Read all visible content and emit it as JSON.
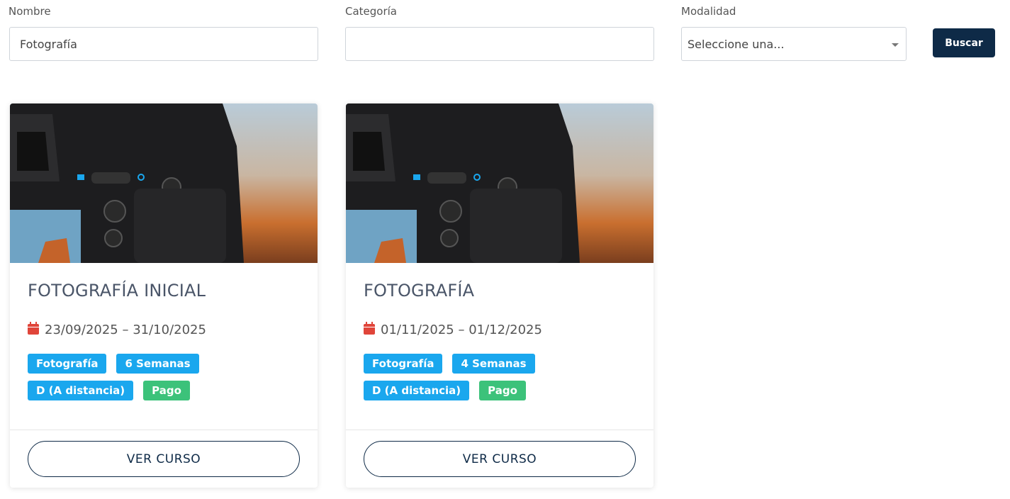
{
  "filters": {
    "name_label": "Nombre",
    "name_value": "Fotografía",
    "category_label": "Categoría",
    "category_value": "",
    "mode_label": "Modalidad",
    "mode_selected": "Seleccione una...",
    "search_button": "Buscar"
  },
  "courses": [
    {
      "title": "FOTOGRAFÍA INICIAL",
      "dates": "23/09/2025 – 31/10/2025",
      "category": "Fotografía",
      "duration": "6 Semanas",
      "mode": "D (A distancia)",
      "price": "Pago",
      "button": "VER CURSO"
    },
    {
      "title": "FOTOGRAFÍA",
      "dates": "01/11/2025 – 01/12/2025",
      "category": "Fotografía",
      "duration": "4 Semanas",
      "mode": "D (A distancia)",
      "price": "Pago",
      "button": "VER CURSO"
    }
  ],
  "colors": {
    "primary": "#0e2a47",
    "badge_blue": "#1aa7ee",
    "badge_green": "#3cc27a",
    "calendar_icon": "#e0453a"
  },
  "icons": {
    "date": "calendar-icon",
    "select": "caret-down-icon"
  }
}
